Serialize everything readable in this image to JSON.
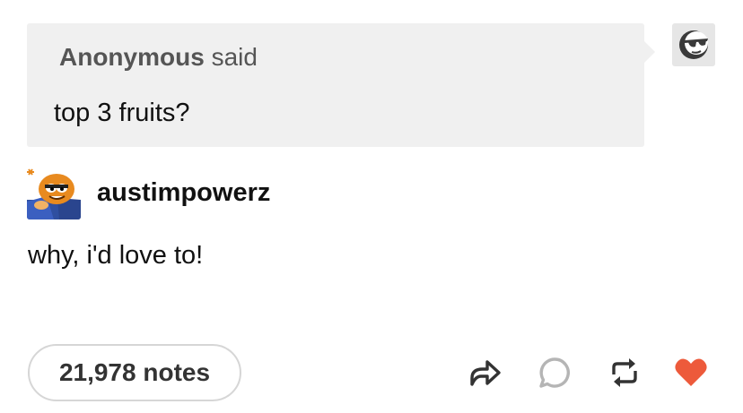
{
  "ask": {
    "asker_name": "Anonymous",
    "asker_said": "said",
    "question": "top 3 fruits?",
    "avatar_icon": "anonymous-sunglasses-icon"
  },
  "answer": {
    "username": "austimpowerz",
    "text": "why, i'd love to!",
    "avatar_icon": "cartoon-cat-avatar"
  },
  "footer": {
    "notes_label": "21,978 notes",
    "actions": [
      {
        "name": "share",
        "icon": "share-arrow-icon"
      },
      {
        "name": "reply",
        "icon": "reply-bubble-icon"
      },
      {
        "name": "reblog",
        "icon": "reblog-icon"
      },
      {
        "name": "like",
        "icon": "heart-icon",
        "liked": true
      }
    ]
  },
  "colors": {
    "ask_background": "#f0f0f0",
    "heart": "#ed5a3b",
    "icon_gray": "#b5b5b5"
  }
}
